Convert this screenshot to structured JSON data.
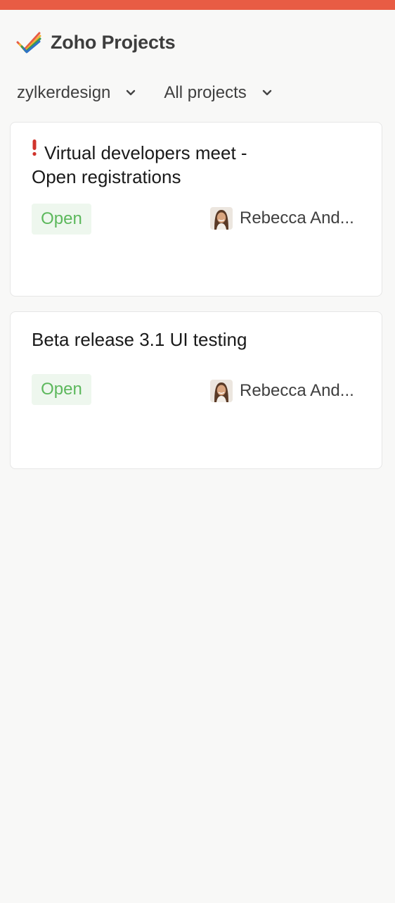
{
  "app": {
    "title": "Zoho Projects",
    "accent_color": "#e85c44",
    "logo_icon": "zoho-check-logo-icon"
  },
  "filters": {
    "portal": {
      "label": "zylkerdesign",
      "icon": "chevron-down-icon"
    },
    "project": {
      "label": "All projects",
      "icon": "chevron-down-icon"
    }
  },
  "tasks": [
    {
      "title_line1": "Virtual developers meet -",
      "title_line2": "Open registrations",
      "priority_icon": "exclamation-icon",
      "status": "Open",
      "status_color": "#5cb85c",
      "assignee": "Rebecca And..."
    },
    {
      "title_line1": "Beta release 3.1 UI testing",
      "status": "Open",
      "status_color": "#5cb85c",
      "assignee": "Rebecca And..."
    }
  ]
}
